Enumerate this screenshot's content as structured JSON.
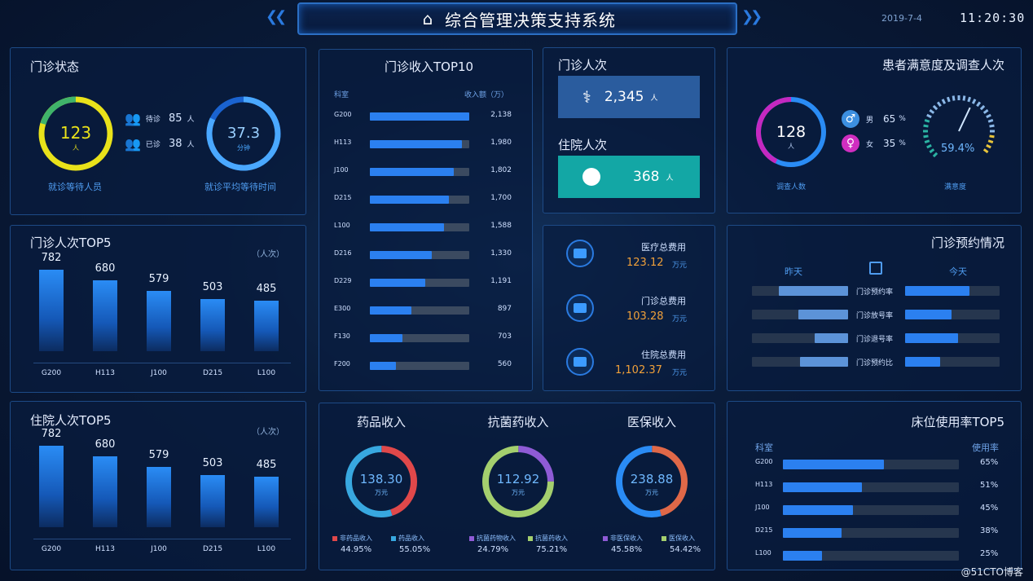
{
  "header": {
    "title": "综合管理决策支持系统",
    "date": "2019-7-4",
    "clock": "11:20:30"
  },
  "visit_status": {
    "title": "门诊状态",
    "waiting_count": "123",
    "waiting_unit": "人",
    "waiting_label": "就诊等待人员",
    "waiting_row": {
      "label": "待诊",
      "value": "85",
      "unit": "人"
    },
    "done_row": {
      "label": "已诊",
      "value": "38",
      "unit": "人"
    },
    "avg_wait": "37.3",
    "avg_wait_unit": "分钟",
    "avg_wait_label": "就诊平均等待时间"
  },
  "visit_top5": {
    "title": "门诊人次TOP5",
    "unit": "（人次）",
    "chart_data": {
      "type": "bar",
      "categories": [
        "G200",
        "H113",
        "J100",
        "D215",
        "L100"
      ],
      "values": [
        782,
        680,
        579,
        503,
        485
      ],
      "ylim": [
        0,
        1000
      ]
    }
  },
  "inpatient_top5": {
    "title": "住院人次TOP5",
    "unit": "（人次）",
    "chart_data": {
      "type": "bar",
      "categories": [
        "G200",
        "H113",
        "J100",
        "D215",
        "L100"
      ],
      "values": [
        782,
        680,
        579,
        503,
        485
      ],
      "ylim": [
        0,
        1000
      ]
    }
  },
  "revenue_top10": {
    "title": "门诊收入TOP10",
    "col1": "科室",
    "col2": "收入额（万）",
    "chart_data": {
      "type": "bar",
      "categories": [
        "G200",
        "H113",
        "J100",
        "D215",
        "L100",
        "D216",
        "D229",
        "E300",
        "F130",
        "F200"
      ],
      "values": [
        2138,
        1980,
        1802,
        1700,
        1588,
        1330,
        1191,
        897,
        703,
        560
      ],
      "labels": [
        "2,138",
        "1,980",
        "1,802",
        "1,700",
        "1,588",
        "1,330",
        "1,191",
        "897",
        "703",
        "560"
      ],
      "xlim": [
        0,
        2138
      ]
    }
  },
  "visits": {
    "title": "门诊人次",
    "value": "2,345",
    "unit": "人"
  },
  "inpatients": {
    "title": "住院人次",
    "value": "368",
    "unit": "人"
  },
  "costs": [
    {
      "label": "医疗总费用",
      "value": "123.12",
      "unit": "万元"
    },
    {
      "label": "门诊总费用",
      "value": "103.28",
      "unit": "万元"
    },
    {
      "label": "住院总费用",
      "value": "1,102.37",
      "unit": "万元"
    }
  ],
  "donuts": [
    {
      "title": "药品收入",
      "value": "138.30",
      "unit": "万元",
      "legend": [
        {
          "name": "非药品收入",
          "pct": "44.95%",
          "color": "#e0484a"
        },
        {
          "name": "药品收入",
          "pct": "55.05%",
          "color": "#38a8e0"
        }
      ],
      "chart_data": {
        "type": "pie",
        "series": [
          {
            "name": "非药品收入",
            "value": 44.95
          },
          {
            "name": "药品收入",
            "value": 55.05
          }
        ]
      }
    },
    {
      "title": "抗菌药收入",
      "value": "112.92",
      "unit": "万元",
      "legend": [
        {
          "name": "抗菌药物收入",
          "pct": "24.79%",
          "color": "#8f5bd6"
        },
        {
          "name": "抗菌药收入",
          "pct": "75.21%",
          "color": "#a4cf6e"
        }
      ],
      "chart_data": {
        "type": "pie",
        "series": [
          {
            "name": "抗菌药物收入",
            "value": 24.79
          },
          {
            "name": "抗菌药收入",
            "value": 75.21
          }
        ]
      }
    },
    {
      "title": "医保收入",
      "value": "238.88",
      "unit": "万元",
      "legend": [
        {
          "name": "非医保收入",
          "pct": "45.58%",
          "color": "#8f5bd6"
        },
        {
          "name": "医保收入",
          "pct": "54.42%",
          "color": "#a4cf6e"
        }
      ],
      "chart_data": {
        "type": "pie",
        "series": [
          {
            "name": "非医保收入",
            "value": 45.58
          },
          {
            "name": "医保收入",
            "value": 54.42
          }
        ]
      }
    }
  ],
  "satisfaction": {
    "title": "患者满意度及调查人次",
    "survey_count": "128",
    "survey_unit": "人",
    "survey_label": "调查人数",
    "male": {
      "label": "男",
      "value": "65",
      "unit": "%"
    },
    "female": {
      "label": "女",
      "value": "35",
      "unit": "%"
    },
    "gauge_value": "59.4%",
    "gauge_fraction": 0.594,
    "gauge_label": "满意度"
  },
  "appointments": {
    "title": "门诊预约情况",
    "yesterday": "昨天",
    "today": "今天",
    "rows": [
      {
        "label": "门诊预约率",
        "yesterday": 0.72,
        "today": 0.68
      },
      {
        "label": "门诊放号率",
        "yesterday": 0.52,
        "today": 0.49
      },
      {
        "label": "门诊退号率",
        "yesterday": 0.35,
        "today": 0.56
      },
      {
        "label": "门诊预约比",
        "yesterday": 0.5,
        "today": 0.37
      }
    ]
  },
  "bed_top5": {
    "title": "床位使用率TOP5",
    "col1": "科室",
    "col2": "使用率",
    "chart_data": {
      "type": "bar",
      "categories": [
        "G200",
        "H113",
        "J100",
        "D215",
        "L100"
      ],
      "values": [
        65,
        51,
        45,
        38,
        25
      ],
      "labels": [
        "65%",
        "51%",
        "45%",
        "38%",
        "25%"
      ],
      "xlim": [
        0,
        100
      ]
    }
  },
  "watermark": "@51CTO博客"
}
